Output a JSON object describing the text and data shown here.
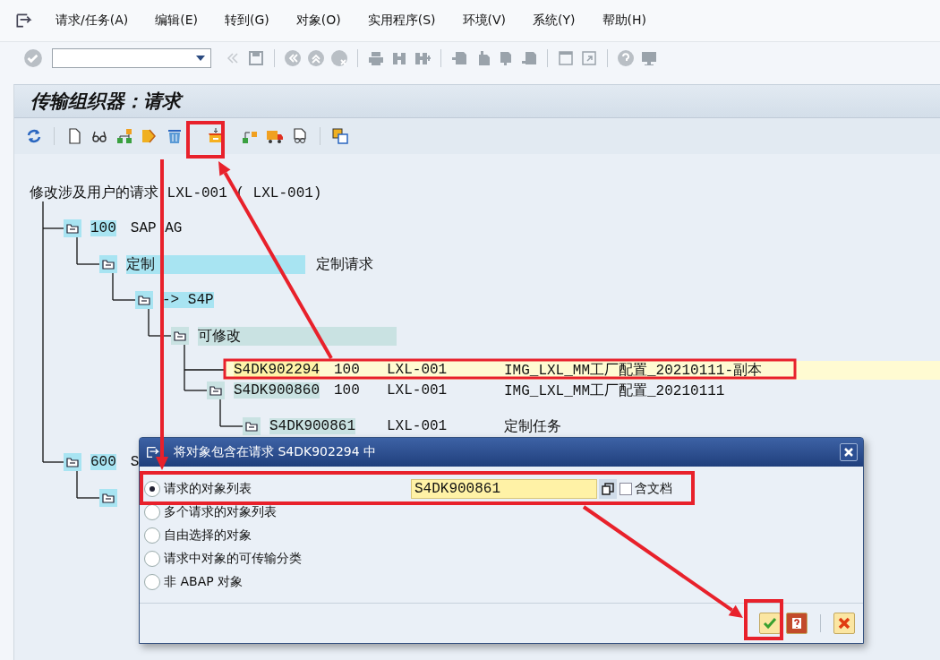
{
  "menu": [
    "请求/任务(A)",
    "编辑(E)",
    "转到(G)",
    "对象(O)",
    "实用程序(S)",
    "环境(V)",
    "系统(Y)",
    "帮助(H)"
  ],
  "title": "传输组织器：请求",
  "tree": {
    "kind": "root",
    "label": "修改涉及用户的请求 LXL-001 ( LXL-001)",
    "children": [
      {
        "kind": "client",
        "number": "100",
        "name": "SAP AG",
        "color": "#a8e4f2",
        "children": [
          {
            "kind": "category",
            "label": "定制",
            "desc": "定制请求",
            "color": "#a8e4f2",
            "children": [
              {
                "kind": "target",
                "label": "-> S4P",
                "color": "#a8e4f2",
                "children": [
                  {
                    "kind": "status",
                    "label": "可修改",
                    "color": "#c9e2e2",
                    "children": [
                      {
                        "kind": "request",
                        "id": "S4DK902294",
                        "client": "100",
                        "user": "LXL-001",
                        "desc": "IMG_LXL_MM工厂配置_20210111-副本",
                        "color": "#fff3a8",
                        "highlighted": true,
                        "folder_icon": false
                      },
                      {
                        "kind": "request",
                        "id": "S4DK900860",
                        "client": "100",
                        "user": "LXL-001",
                        "desc": "IMG_LXL_MM工厂配置_20210111",
                        "color": "#c9e2e2",
                        "highlighted": false,
                        "folder_icon": true,
                        "children": [
                          {
                            "kind": "task",
                            "id": "S4DK900861",
                            "user": "LXL-001",
                            "desc": "定制任务",
                            "color": "#c9e2e2"
                          }
                        ]
                      }
                    ]
                  }
                ]
              }
            ]
          }
        ]
      },
      {
        "kind": "client",
        "number": "600",
        "name": "S",
        "color": "#a8e4f2",
        "children": [
          {
            "kind": "category",
            "color": "#a8e4f2"
          }
        ]
      }
    ]
  },
  "dialog": {
    "title": "将对象包含在请求 S4DK902294 中",
    "options": [
      {
        "label": "请求的对象列表",
        "selected": true
      },
      {
        "label": "多个请求的对象列表",
        "selected": false
      },
      {
        "label": "自由选择的对象",
        "selected": false
      },
      {
        "label": "请求中对象的可传输分类",
        "selected": false
      },
      {
        "label": "非 ABAP 对象",
        "selected": false
      }
    ],
    "request_field": {
      "value": "S4DK900861"
    },
    "checkbox": {
      "label": "含文档",
      "checked": false
    }
  }
}
